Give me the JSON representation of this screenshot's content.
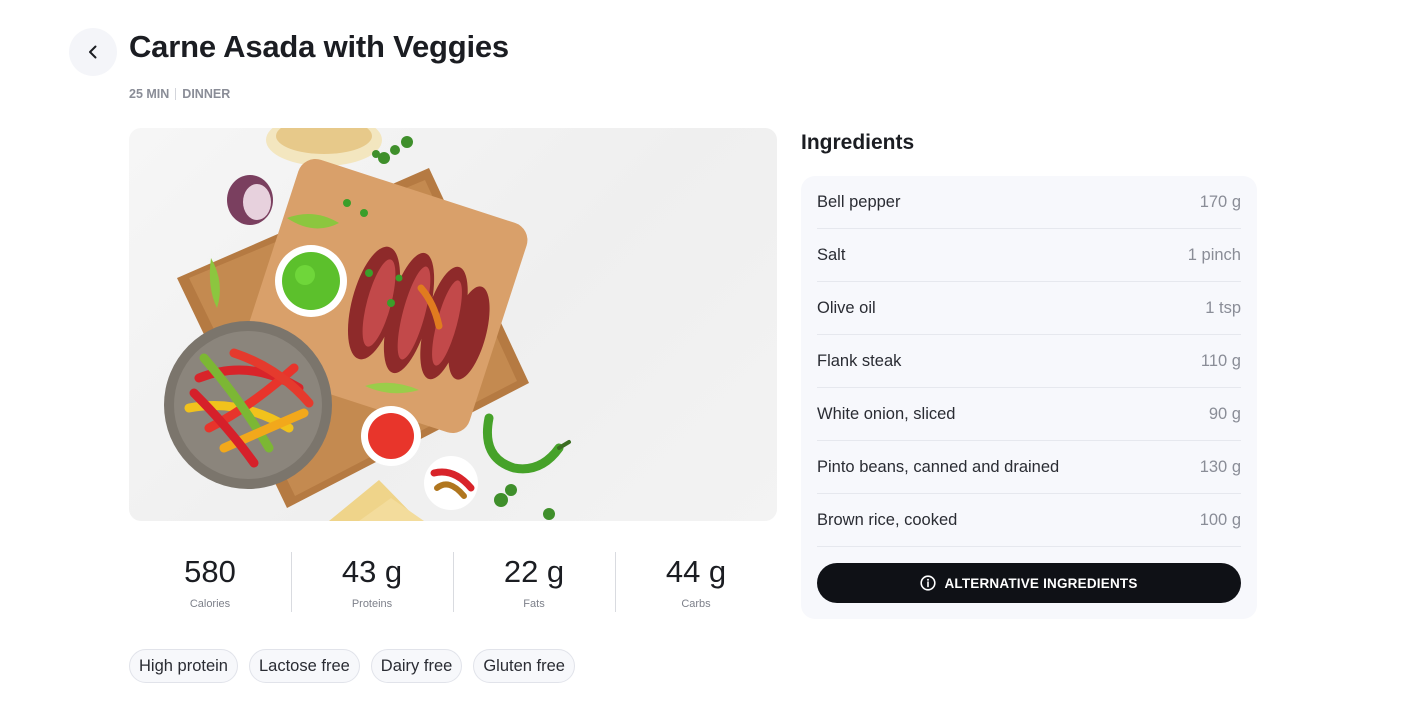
{
  "recipe": {
    "title": "Carne Asada with Veggies",
    "time": "25 MIN",
    "category": "DINNER"
  },
  "nutrition": [
    {
      "value": "580",
      "label": "Calories"
    },
    {
      "value": "43 g",
      "label": "Proteins"
    },
    {
      "value": "22 g",
      "label": "Fats"
    },
    {
      "value": "44 g",
      "label": "Carbs"
    }
  ],
  "tags": [
    "High protein",
    "Lactose free",
    "Dairy free",
    "Gluten free"
  ],
  "ingredients": {
    "title": "Ingredients",
    "items": [
      {
        "name": "Bell pepper",
        "qty": "170 g"
      },
      {
        "name": "Salt",
        "qty": "1 pinch"
      },
      {
        "name": "Olive oil",
        "qty": "1 tsp"
      },
      {
        "name": "Flank steak",
        "qty": "110 g"
      },
      {
        "name": "White onion, sliced",
        "qty": "90 g"
      },
      {
        "name": "Pinto beans, canned and drained",
        "qty": "130 g"
      },
      {
        "name": "Brown rice, cooked",
        "qty": "100 g"
      }
    ],
    "alt_button": "ALTERNATIVE INGREDIENTS"
  },
  "icons": {
    "back": "chevron-left-icon",
    "info": "info-circle-icon"
  },
  "colors": {
    "primary_button": "#0f1116",
    "card_background": "#f7f8fc",
    "muted_text": "#8a8d97"
  }
}
